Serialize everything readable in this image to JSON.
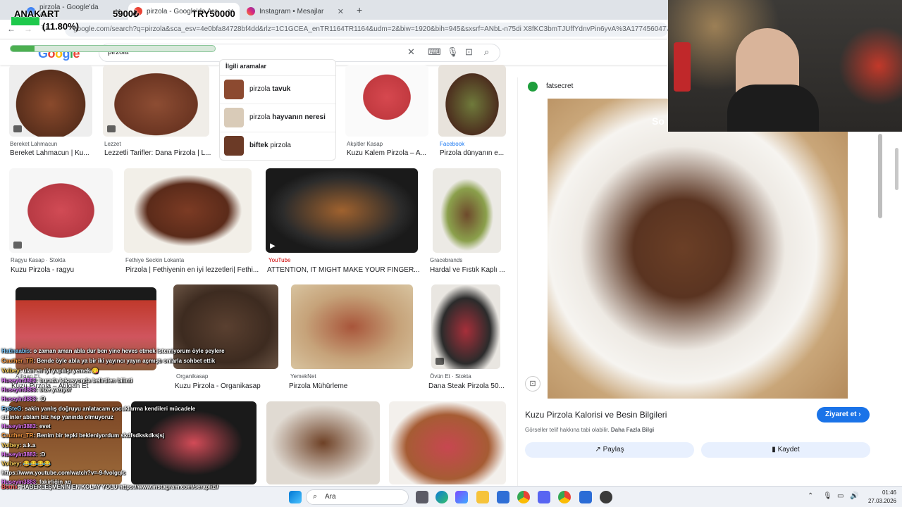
{
  "browser": {
    "tabs": [
      {
        "label": "pirzola - Google'da Ara",
        "active": false
      },
      {
        "label": "pirzola - Google'da Ara",
        "active": true
      },
      {
        "label": "Instagram • Mesajlar",
        "active": false
      }
    ],
    "new_tab": "+",
    "url": "google.com/search?q=pirzola&sca_esv=4e0bfa84728bf4dd&rlz=1C1GCEA_enTR1164TR1164&udm=2&biw=1920&bih=945&sxsrf=ANbL-n75di X8fKC3bmTJUffYdnvPin6yvA%3A1774560477998&ei=3aTFaD"
  },
  "overlay": {
    "label": "ANAKART",
    "current": "5900₺",
    "target": "TRY50000",
    "percent": "(11.80%)",
    "progress": 0.118
  },
  "google": {
    "logo": "Google",
    "query": "pirzola",
    "icons": [
      "clear-icon",
      "keyboard-icon",
      "mic-icon",
      "lens-icon",
      "search-icon"
    ]
  },
  "related": {
    "heading": "İlgili aramalar",
    "items": [
      {
        "prefix": "pirzola",
        "bold": "tavuk",
        "order": "after"
      },
      {
        "prefix": "pirzola",
        "bold": "hayvanın neresi",
        "order": "after"
      },
      {
        "prefix": "pirzola",
        "bold": "biftek",
        "order": "before"
      }
    ]
  },
  "results": [
    {
      "source": "Bereket Lahmacun",
      "title": "Bereket Lahmacun | Ku..."
    },
    {
      "source": "Lezzet",
      "title": "Lezzetli Tarifler: Dana Pirzola | L..."
    },
    {
      "source": "Akşitler Kasap",
      "title": "Kuzu Kalem Pirzola – A..."
    },
    {
      "source": "Facebook",
      "title": "Pirzola dünyanın e..."
    },
    {
      "source": "Ragyu Kasap · Stokta",
      "title": "Kuzu Pirzola - ragyu"
    },
    {
      "source": "Fethiye Seckin Lokanta",
      "title": "Pirzola | Fethiyenin en iyi lezzetleri| Fethi..."
    },
    {
      "source": "YouTube",
      "title": "ATTENTION, IT MIGHT MAKE YOUR FINGER..."
    },
    {
      "source": "Gracebrands",
      "title": "Hardal ve Fıstık Kaplı ..."
    },
    {
      "source": "Atilgan Et",
      "title": "Kuzu Pirzola – Atilgan Et"
    },
    {
      "source": "Organikasap",
      "title": "Kuzu Pirzola - Organikasap"
    },
    {
      "source": "YemekNet",
      "title": "Pirzola Mühürleme"
    },
    {
      "source": "Övün Et · Stokta",
      "title": "Dana Steak Pirzola 50..."
    }
  ],
  "panel": {
    "source": "fatsecret",
    "title": "Kuzu Pirzola Kalorisi ve Besin Bilgileri",
    "visit": "Ziyaret et",
    "notice": "Görseller telif hakkına tabi olabilir.",
    "notice_link": "Daha Fazla Bilgi",
    "share": "Paylaş",
    "save": "Kaydet",
    "overlay_text": "So"
  },
  "chat": [
    {
      "user": "Hatinaabis",
      "text": "o zaman aman abla dur ben yine heves etmek istemiyorum öyle şeylere"
    },
    {
      "user": "Cauther_TR",
      "text": "Bende öyle abla ya bir iki yayıncı yayın açmıştı onlarla sohbet ettik"
    },
    {
      "user": "Volbey",
      "text": "ulan en iyi yapılışı yemek 😋"
    },
    {
      "user": "Huseyin3883",
      "text": "burada lokasyonda belirtilen bilinti"
    },
    {
      "user": "Huseyin3883",
      "text": "bize yazıyor"
    },
    {
      "user": "Huseyin3883",
      "text": ":D"
    },
    {
      "user": "FpSteG",
      "text": "sakin yanlış doğruyu anlatacam çocuklarma kendileri mücadele"
    },
    {
      "user": "",
      "text": "etsinler ablam biz hep yanında olmuyoruz"
    },
    {
      "user": "Huseyin3883",
      "text": "evet"
    },
    {
      "user": "Cauther_TR",
      "text": "Benim bir tepki bekleniyordum skdfsdkskdksjsj"
    },
    {
      "user": "Volbey",
      "text": "a.k.a"
    },
    {
      "user": "Huseyin3883",
      "text": ":D"
    },
    {
      "user": "Volbey",
      "text": "😂😂😂😂"
    },
    {
      "user": "",
      "text": "https://www.youtube.com/watch?v=-9-fvolgqlc"
    },
    {
      "user": "Huseyin3883",
      "text": "fakirliğin aq"
    },
    {
      "user": "Botrix",
      "text": "HABERLEŞMENİN EN KOLAY YOLU https://www.instagram.com/seraplizi/"
    }
  ],
  "taskbar": {
    "search_placeholder": "Ara",
    "time": "01:46",
    "date": "27.03.2026"
  }
}
